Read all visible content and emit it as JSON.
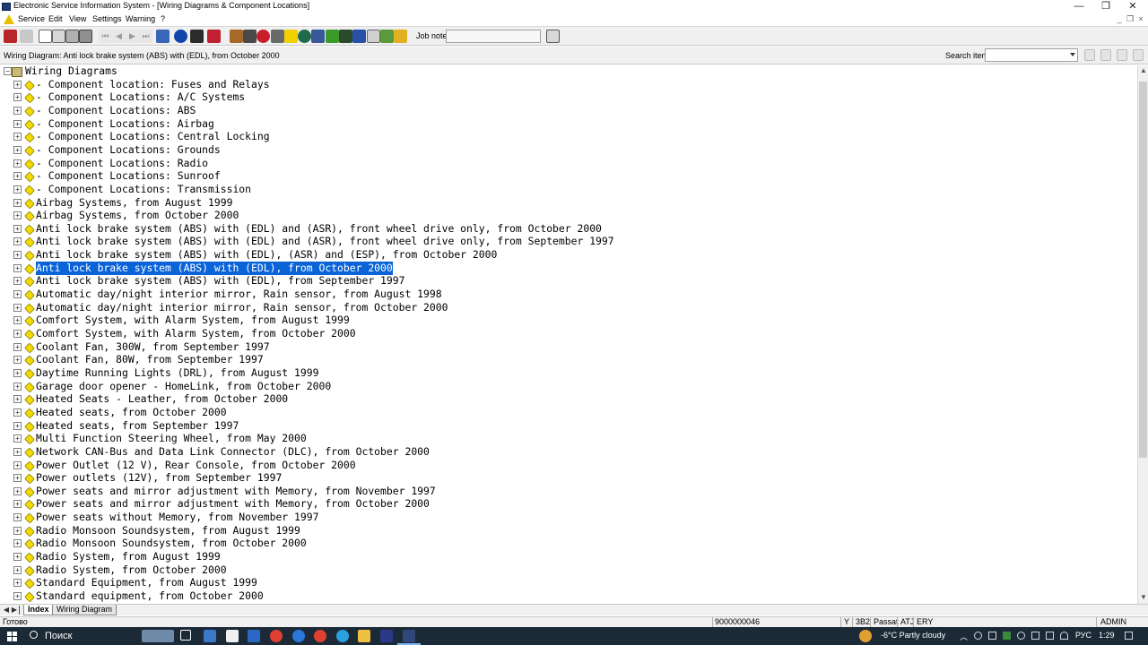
{
  "window": {
    "title": "Electronic Service Information System - [Wiring Diagrams & Component Locations]",
    "minimize_glyph": "—",
    "maximize_glyph": "❐",
    "close_glyph": "✕"
  },
  "menubar": {
    "items": [
      "Service",
      "Edit",
      "View",
      "Settings",
      "Warning",
      "?"
    ]
  },
  "toolbar": {
    "job_note_label": "Job note:",
    "job_note_value": ""
  },
  "infobar": {
    "caption": "Wiring Diagram: Anti lock brake system (ABS) with (EDL), from October 2000",
    "search_label": "Search item:",
    "search_value": ""
  },
  "tree": {
    "root": "Wiring Diagrams",
    "selected_index": 14,
    "items": [
      "- Component location: Fuses and Relays",
      "- Component Locations: A/C Systems",
      "- Component Locations: ABS",
      "- Component Locations: Airbag",
      "- Component Locations: Central Locking",
      "- Component Locations: Grounds",
      "- Component Locations: Radio",
      "- Component Locations: Sunroof",
      "- Component Locations: Transmission",
      "Airbag Systems, from August 1999",
      "Airbag Systems, from October 2000",
      "Anti lock brake system (ABS) with (EDL) and (ASR), front wheel drive only, from October 2000",
      "Anti lock brake system (ABS) with (EDL) and (ASR), front wheel drive only, from September 1997",
      "Anti lock brake system (ABS) with (EDL), (ASR) and (ESP), from October 2000",
      "Anti lock brake system (ABS) with (EDL), from October 2000",
      "Anti lock brake system (ABS) with (EDL), from September 1997",
      "Automatic day/night interior mirror, Rain sensor, from August 1998",
      "Automatic day/night interior mirror, Rain sensor, from October 2000",
      "Comfort System, with Alarm System, from August 1999",
      "Comfort System, with Alarm System, from October 2000",
      "Coolant Fan, 300W, from September 1997",
      "Coolant Fan, 80W, from September 1997",
      "Daytime Running Lights (DRL), from August 1999",
      "Garage door opener - HomeLink, from October 2000",
      "Heated Seats - Leather, from October 2000",
      "Heated seats, from October 2000",
      "Heated seats, from September 1997",
      "Multi Function Steering Wheel, from May 2000",
      "Network CAN-Bus and Data Link Connector (DLC), from October 2000",
      "Power Outlet (12 V), Rear Console, from October 2000",
      "Power outlets (12V), from September 1997",
      "Power seats and mirror adjustment with Memory, from November 1997",
      "Power seats and mirror adjustment with Memory, from October 2000",
      "Power seats without Memory, from November 1997",
      "Radio Monsoon Soundsystem, from August 1999",
      "Radio Monsoon Soundsystem, from October 2000",
      "Radio System, from August 1999",
      "Radio System, from October 2000",
      "Standard Equipment, from August 1999",
      "Standard equipment, from October 2000"
    ]
  },
  "tabs": {
    "index": "Index",
    "wiring": "Wiring Diagram"
  },
  "statusbar": {
    "left": "Готово",
    "code": "9000000046",
    "y": "Y",
    "model": "3B2",
    "name": "Passat",
    "atj": "ATJ",
    "ery": "ERY",
    "user": "ADMIN"
  },
  "taskbar": {
    "search_placeholder": "Поиск",
    "weather": "-6°C  Partly cloudy",
    "language": "РУС",
    "time": "1:29"
  }
}
